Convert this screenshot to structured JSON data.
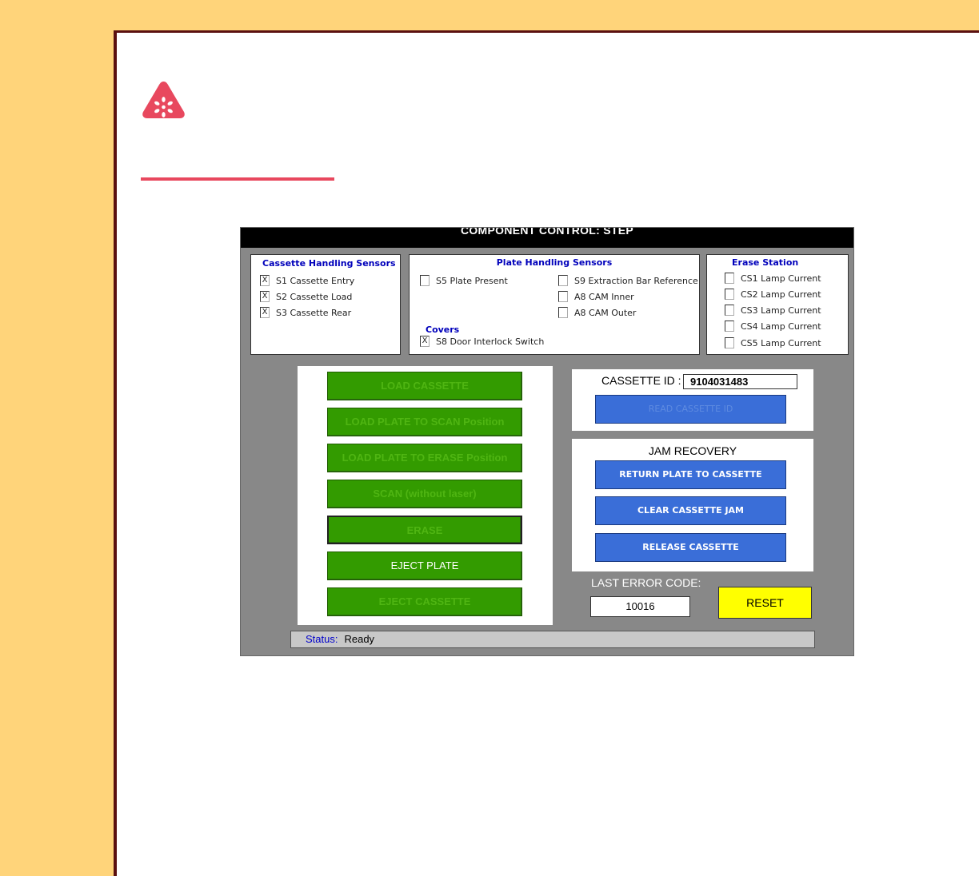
{
  "screen": {
    "title": "COMPONENT CONTROL: STEP",
    "cassette_sensors": {
      "title": "Cassette Handling Sensors",
      "items": [
        {
          "label": "S1 Cassette Entry",
          "mark": "X"
        },
        {
          "label": "S2 Cassette Load",
          "mark": "X"
        },
        {
          "label": "S3 Cassette Rear",
          "mark": "X"
        }
      ]
    },
    "plate_sensors": {
      "title": "Plate Handling Sensors",
      "left_items": [
        {
          "label": "S5 Plate Present",
          "mark": ""
        }
      ],
      "right_items": [
        {
          "label": "S9 Extraction Bar Reference",
          "mark": ""
        },
        {
          "label": "A8 CAM Inner",
          "mark": ""
        },
        {
          "label": "A8 CAM Outer",
          "mark": ""
        }
      ],
      "covers_title": "Covers",
      "covers_items": [
        {
          "label": "S8 Door Interlock Switch",
          "mark": "X"
        }
      ]
    },
    "erase_station": {
      "title": "Erase Station",
      "items": [
        {
          "label": "CS1 Lamp Current",
          "mark": ""
        },
        {
          "label": "CS2 Lamp Current",
          "mark": ""
        },
        {
          "label": "CS3 Lamp Current",
          "mark": ""
        },
        {
          "label": "CS4 Lamp Current",
          "mark": ""
        },
        {
          "label": "CS5 Lamp Current",
          "mark": ""
        }
      ]
    },
    "actions": {
      "load_cassette": "LOAD CASSETTE",
      "load_plate_scan": "LOAD PLATE TO SCAN Position",
      "load_plate_erase": "LOAD PLATE TO ERASE Position",
      "scan": "SCAN (without laser)",
      "erase": "ERASE",
      "eject_plate": "EJECT PLATE",
      "eject_cassette": "EJECT CASSETTE"
    },
    "cassette_id": {
      "label": "CASSETTE ID :",
      "value": "9104031483",
      "read_button": "READ CASSETTE ID"
    },
    "jam_recovery": {
      "title": "JAM RECOVERY",
      "return_plate": "RETURN PLATE TO CASSETTE",
      "clear_jam": "CLEAR CASSETTE JAM",
      "release": "RELEASE CASSETTE"
    },
    "error": {
      "label": "LAST ERROR CODE:",
      "value": "10016",
      "reset": "RESET"
    },
    "status": {
      "label": "Status:",
      "value": "Ready"
    }
  },
  "colors": {
    "page_background": "#ffd47a",
    "accent_rule": "#e8485e",
    "warning_icon": "#e8485e",
    "button_green": "#339b00",
    "button_blue": "#3a6ed8",
    "reset_yellow": "#ffff00",
    "screen_gray": "#888888"
  },
  "icons": {
    "warning": "important-triangle-icon"
  }
}
